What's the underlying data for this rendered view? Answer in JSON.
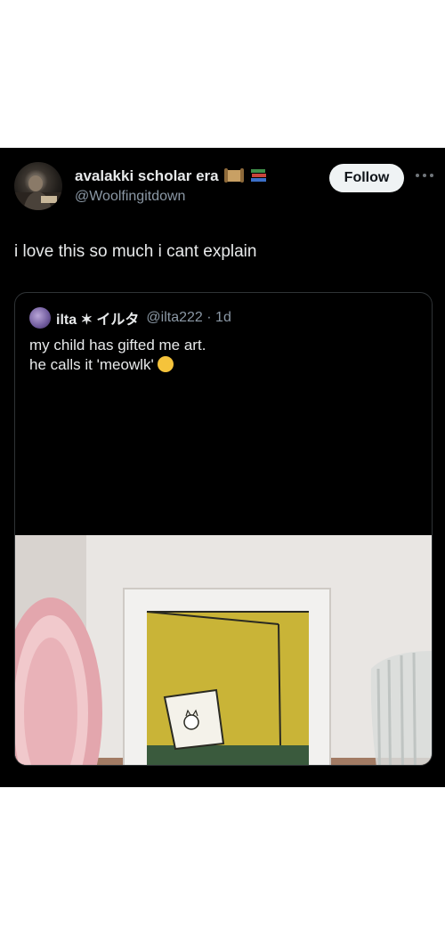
{
  "tweet": {
    "display_name": "avalakki scholar era",
    "name_emojis": [
      "scroll-emoji",
      "books-emoji"
    ],
    "handle": "@Woolfingitdown",
    "follow_label": "Follow",
    "text": "i love this so much i cant explain"
  },
  "quoted": {
    "display_name": "ilta ✶ イルタ",
    "handle": "@ilta222",
    "separator": "·",
    "time": "1d",
    "line1": "my child has gifted me art.",
    "line2": "he calls it 'meowlk'",
    "emoji": "grinning-face-emoji"
  },
  "colors": {
    "post_bg": "#000000",
    "text": "#e7e9ea",
    "muted": "#8b98a5",
    "follow_bg": "#eff3f4",
    "follow_text": "#0f1419",
    "border": "#2f3336"
  }
}
